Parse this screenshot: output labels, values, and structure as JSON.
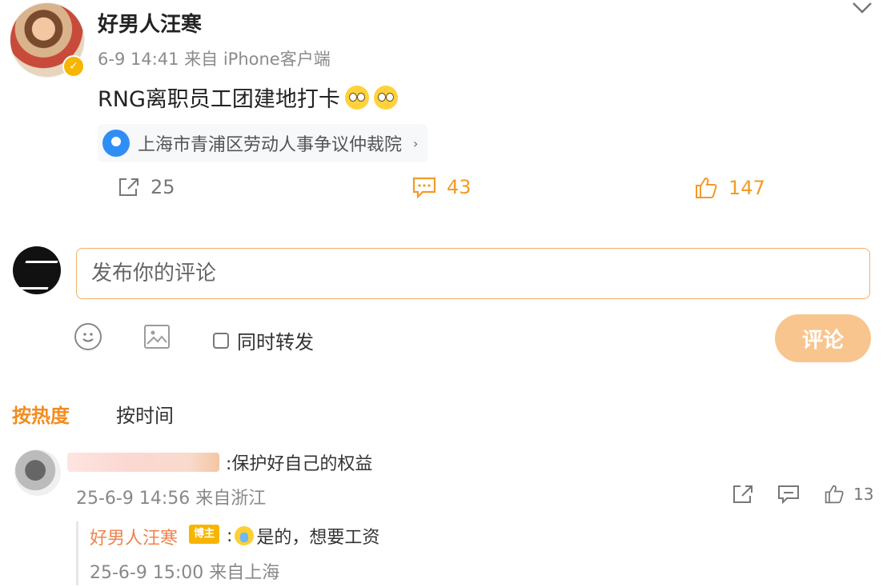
{
  "post": {
    "username": "好男人汪寒",
    "meta": "6-9 14:41  来自 iPhone客户端",
    "text": "RNG离职员工团建地打卡",
    "location": "上海市青浦区劳动人事争议仲裁院",
    "location_arrow": "›",
    "actions": {
      "repost_count": "25",
      "comment_count": "43",
      "like_count": "147"
    }
  },
  "composer": {
    "placeholder": "发布你的评论",
    "repost_label": "同时转发",
    "submit_label": "评论"
  },
  "sort_tabs": {
    "hot": "按热度",
    "time": "按时间"
  },
  "comments": [
    {
      "text": ":保护好自己的权益",
      "meta": "25-6-9 14:56 来自浙江",
      "like_count": "13",
      "reply": {
        "author": "好男人汪寒",
        "badge": "博主",
        "prefix": ":",
        "text": "是的，想要工资",
        "meta": "25-6-9 15:00 来自上海"
      }
    }
  ],
  "colors": {
    "accent": "#f39a27",
    "input_border": "#f1b067",
    "submit_bg": "#f9c58e",
    "location_pin": "#2f8ef4"
  },
  "icons": [
    "chevron-down-icon",
    "verified-icon",
    "emoji-icon",
    "location-pin-icon",
    "repost-icon",
    "comment-icon",
    "like-icon",
    "image-icon",
    "share-icon"
  ]
}
